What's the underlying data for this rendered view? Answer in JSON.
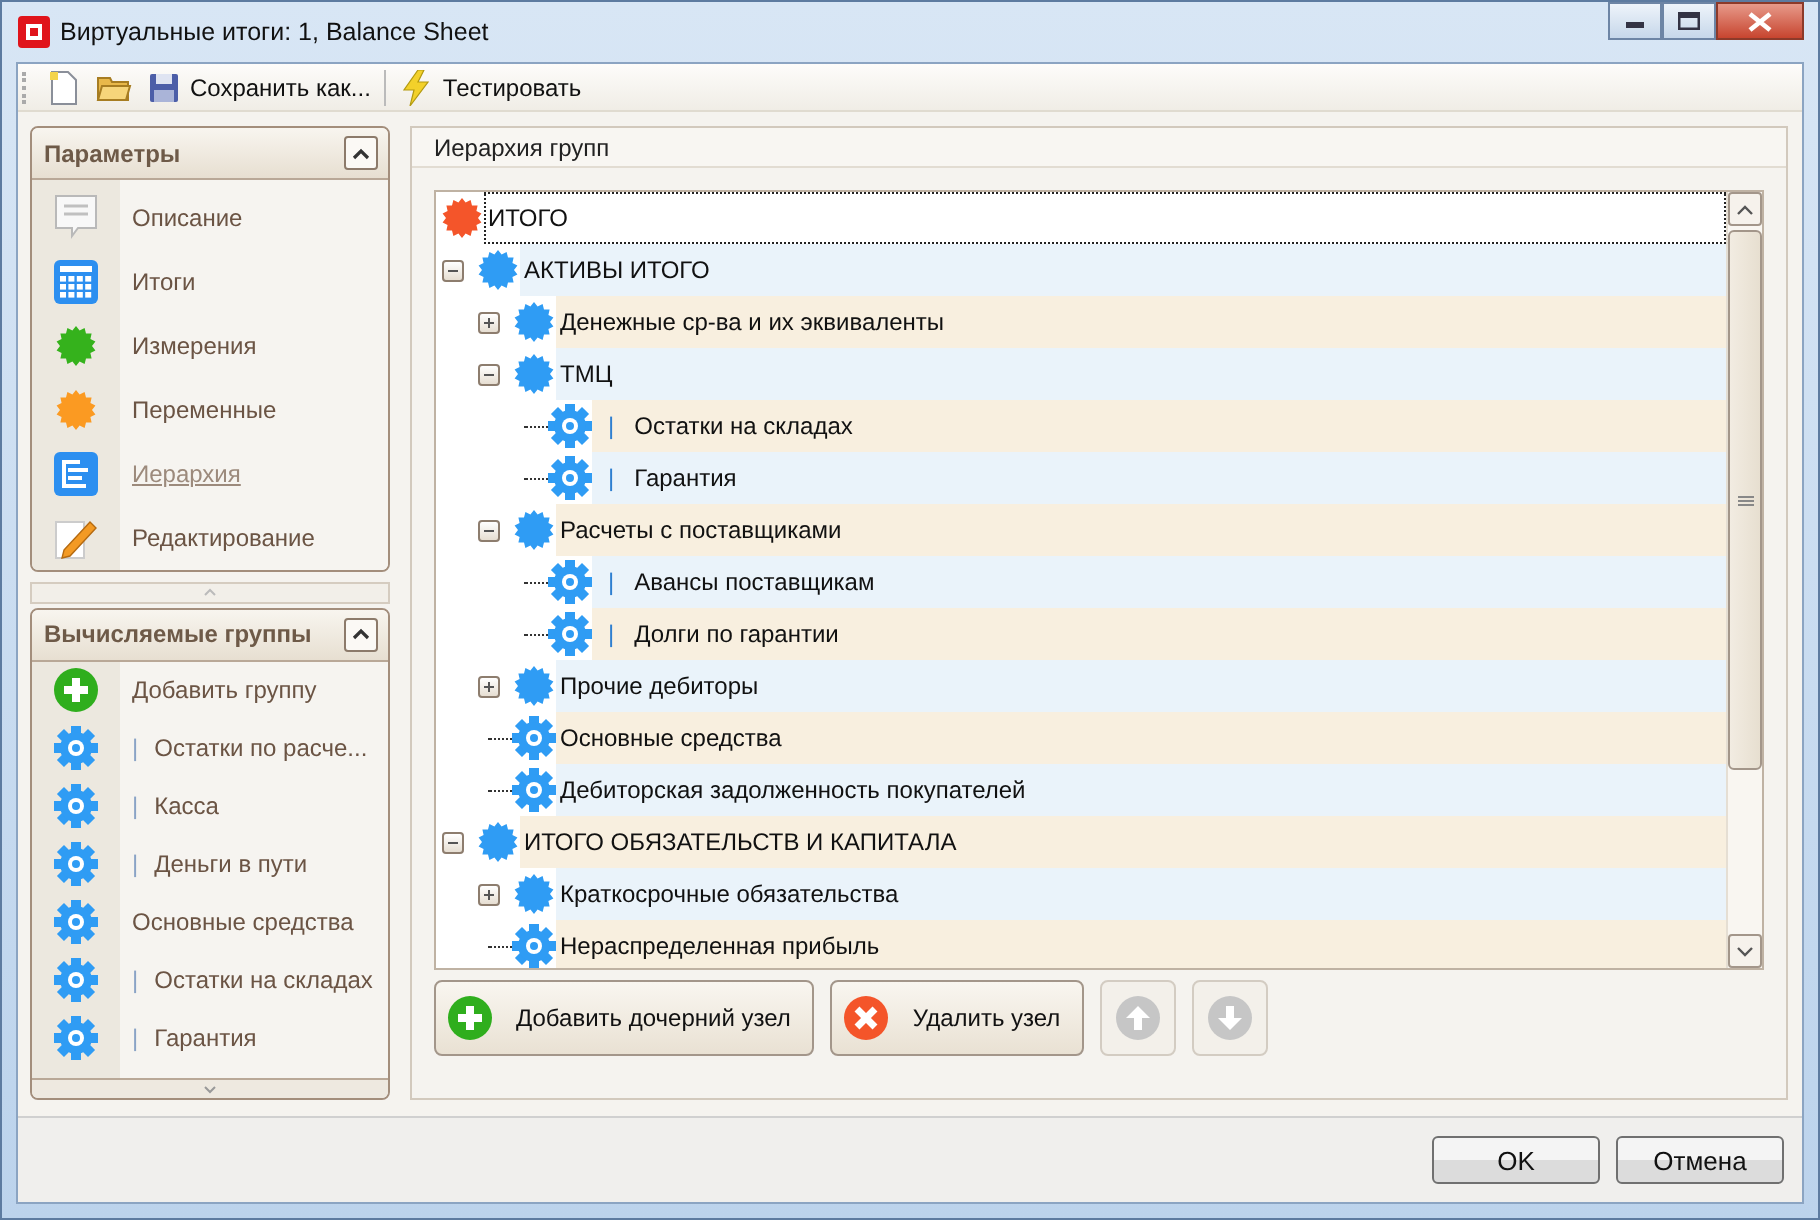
{
  "window": {
    "title": "Виртуальные итоги: 1, Balance Sheet"
  },
  "toolbar": [
    {
      "kind": "new"
    },
    {
      "kind": "open"
    },
    {
      "kind": "save",
      "label": "Сохранить как..."
    },
    {
      "kind": "test",
      "label": "Тестировать"
    }
  ],
  "parameters_panel": {
    "title": "Параметры",
    "items": [
      {
        "kind": "note",
        "label": "Описание",
        "selected": false
      },
      {
        "kind": "calc",
        "label": "Итоги",
        "selected": false
      },
      {
        "kind": "green",
        "label": "Измерения",
        "selected": false
      },
      {
        "kind": "orange",
        "label": "Переменные",
        "selected": false
      },
      {
        "kind": "hier",
        "label": "Иерархия",
        "selected": true
      },
      {
        "kind": "pencil",
        "label": "Редактирование",
        "selected": false
      }
    ]
  },
  "groups_panel": {
    "title": "Вычисляемые группы",
    "items": [
      {
        "kind": "add",
        "label": "Добавить группу"
      },
      {
        "kind": "gear",
        "prefix": "|",
        "label": "Остатки по расче..."
      },
      {
        "kind": "gear",
        "prefix": "|",
        "label": "Касса"
      },
      {
        "kind": "gear",
        "prefix": "|",
        "label": "Деньги в пути"
      },
      {
        "kind": "gear",
        "label": "Основные средства"
      },
      {
        "kind": "gear",
        "prefix": "|",
        "label": "Остатки на складах"
      },
      {
        "kind": "gear",
        "prefix": "|",
        "label": "Гарантия"
      }
    ]
  },
  "hierarchy": {
    "title": "Иерархия групп",
    "tree": [
      {
        "kind": "root",
        "label": "ИТОГО",
        "selected": true,
        "children": [
          {
            "kind": "group",
            "label": "АКТИВЫ ИТОГО",
            "selected": false,
            "expanded": true,
            "children": [
              {
                "kind": "group",
                "label": "Денежные ср-ва и их эквиваленты",
                "selected": false,
                "expanded": false
              },
              {
                "kind": "group",
                "label": "ТМЦ",
                "selected": false,
                "expanded": true,
                "children": [
                  {
                    "kind": "item",
                    "prefix": "|",
                    "label": "Остатки на складах",
                    "selected": false
                  },
                  {
                    "kind": "item",
                    "prefix": "|",
                    "label": "Гарантия",
                    "selected": false
                  }
                ]
              },
              {
                "kind": "group",
                "label": "Расчеты с поставщиками",
                "selected": false,
                "expanded": true,
                "children": [
                  {
                    "kind": "item",
                    "prefix": "|",
                    "label": "Авансы поставщикам",
                    "selected": false
                  },
                  {
                    "kind": "item",
                    "prefix": "|",
                    "label": "Долги по гарантии",
                    "selected": false
                  }
                ]
              },
              {
                "kind": "group",
                "label": "Прочие дебиторы",
                "selected": false,
                "expanded": false
              },
              {
                "kind": "item",
                "label": "Основные средства",
                "selected": false
              },
              {
                "kind": "item",
                "label": "Дебиторская задолженность покупателей",
                "selected": false
              }
            ]
          },
          {
            "kind": "group",
            "label": "ИТОГО ОБЯЗАТЕЛЬСТВ И КАПИТАЛА",
            "selected": false,
            "expanded": true,
            "children": [
              {
                "kind": "group",
                "label": "Краткосрочные обязательства",
                "selected": false,
                "expanded": false
              },
              {
                "kind": "item",
                "label": "Нераспределенная прибыль",
                "selected": false
              }
            ]
          }
        ]
      }
    ],
    "buttons": [
      {
        "kind": "add",
        "label": "Добавить дочерний узел",
        "disabled": false
      },
      {
        "kind": "delete",
        "label": "Удалить узел",
        "disabled": false
      },
      {
        "kind": "up",
        "disabled": true
      },
      {
        "kind": "down",
        "disabled": true
      }
    ]
  },
  "dialog_buttons": [
    "OK",
    "Отмена"
  ]
}
